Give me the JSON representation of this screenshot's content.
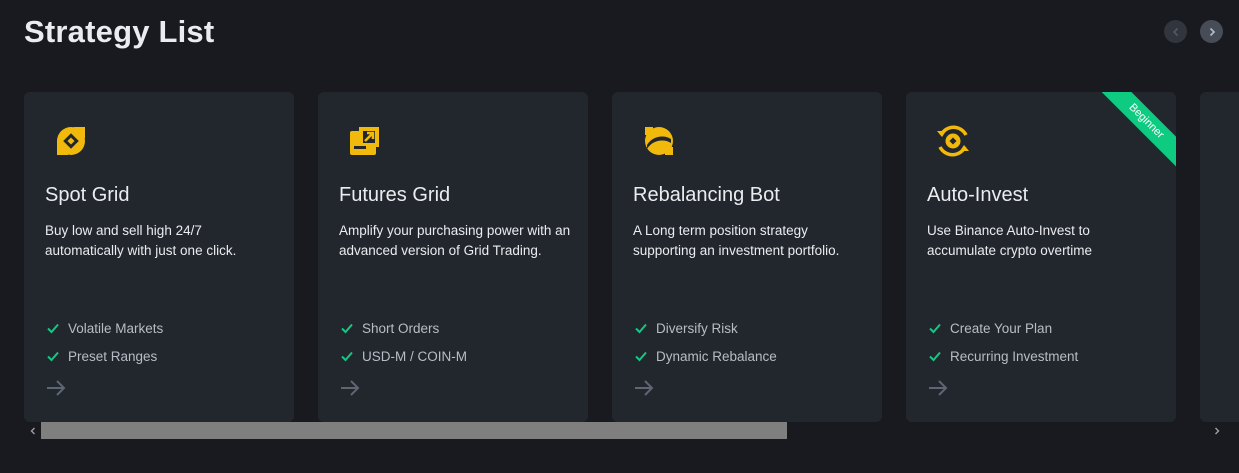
{
  "header": {
    "title": "Strategy List"
  },
  "colors": {
    "background": "#181a20",
    "card": "#22272e",
    "accent_yellow": "#f0b90b",
    "check_green": "#0ecb81",
    "ribbon": "#0ecb81"
  },
  "cards": [
    {
      "title": "Spot Grid",
      "description": "Buy low and sell high 24/7 automatically with just one click.",
      "icon": "spot-grid-icon",
      "features": [
        "Volatile Markets",
        "Preset Ranges"
      ]
    },
    {
      "title": "Futures Grid",
      "description": "Amplify your purchasing power with an advanced version of Grid Trading.",
      "icon": "futures-grid-icon",
      "features": [
        "Short Orders",
        "USD-M / COIN-M"
      ]
    },
    {
      "title": "Rebalancing Bot",
      "description": "A Long term position strategy supporting an investment portfolio.",
      "icon": "rebalancing-bot-icon",
      "features": [
        "Diversify Risk",
        "Dynamic Rebalance"
      ]
    },
    {
      "title": "Auto-Invest",
      "description": "Use Binance Auto-Invest to accumulate crypto overtime",
      "icon": "auto-invest-icon",
      "features": [
        "Create Your Plan",
        "Recurring Investment"
      ],
      "ribbon": "Beginner"
    }
  ]
}
